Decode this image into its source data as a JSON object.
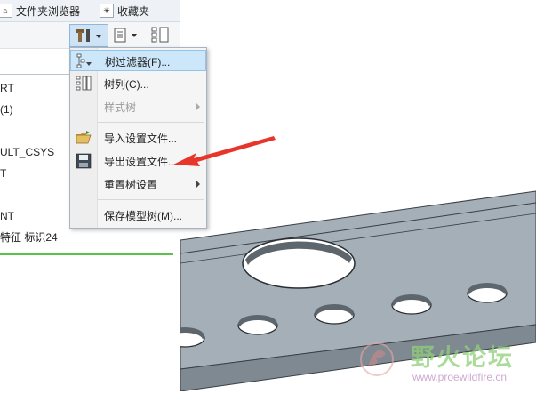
{
  "tabs": [
    {
      "label": "文件夹浏览器",
      "icon": "folder-browser-icon"
    },
    {
      "label": "收藏夹",
      "icon": "favorites-icon"
    }
  ],
  "toolbar": {
    "settings_icon": "tree-settings-icon",
    "columns_icon": "tree-columns-icon",
    "filter_icon": "tree-filter-icon"
  },
  "tree": {
    "items": [
      "RT",
      "(1)",
      "ULT_CSYS",
      "T",
      "NT",
      "特征 标识24"
    ]
  },
  "menu": {
    "items": [
      {
        "label": "树过滤器(F)...",
        "icon": "tree-filter-icon",
        "hover": true
      },
      {
        "label": "树列(C)...",
        "icon": "tree-columns-icon"
      },
      {
        "label": "样式树",
        "disabled": true,
        "submenu": true
      },
      {
        "label": "导入设置文件...",
        "icon": "open-folder-icon"
      },
      {
        "label": "导出设置文件...",
        "icon": "save-icon"
      },
      {
        "label": "重置树设置",
        "submenu": true
      },
      {
        "label": "保存模型树(M)..."
      }
    ]
  },
  "watermark": {
    "title": "野火论坛",
    "url": "www.proewildfire.cn"
  },
  "colors": {
    "menu_hover": "#cde7fa",
    "arrow": "#e8352b",
    "model_top": "#a4afb8",
    "model_side": "#7f8991",
    "green_line": "#59c34a"
  }
}
